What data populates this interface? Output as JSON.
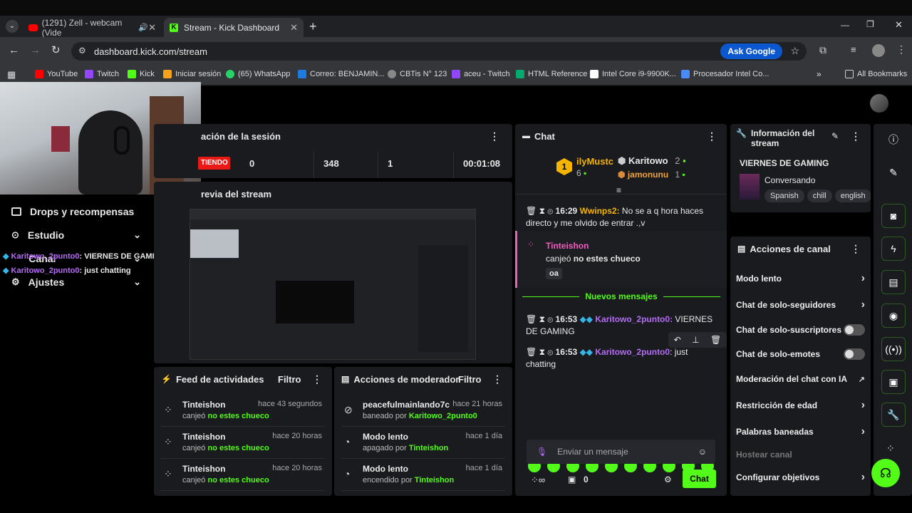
{
  "browser": {
    "tabs": [
      {
        "label": "(1291) Zell - webcam (Vide"
      },
      {
        "label": "Stream - Kick Dashboard"
      }
    ],
    "url": "dashboard.kick.com/stream",
    "ask_google": "Ask Google",
    "bookmarks": [
      "YouTube",
      "Twitch",
      "Kick",
      "Iniciar sesión",
      "(65) WhatsApp",
      "Correo: BENJAMIN...",
      "CBTis N° 123",
      "aceu - Twitch",
      "HTML Reference",
      "Intel Core i9-9900K...",
      "Procesador Intel Co..."
    ],
    "all_bookmarks": "All Bookmarks"
  },
  "sidebar": {
    "items": [
      {
        "label": "Drops y recompensas"
      },
      {
        "label": "Estudio"
      },
      {
        "label": "Canal"
      },
      {
        "label": "Ajustes"
      }
    ],
    "overlay_chat": [
      {
        "user": "Karitowo_2punto0",
        "text": ": VIERNES DE GAMING"
      },
      {
        "user": "Karitowo_2punto0",
        "text": ": just chatting"
      }
    ]
  },
  "session": {
    "title": "ación de la sesión",
    "status": "TIENDO",
    "stats": [
      "0",
      "348",
      "1",
      "00:01:08"
    ]
  },
  "preview": {
    "title": "revia del stream"
  },
  "feed": {
    "title": "Feed de actividades",
    "filter": "Filtro",
    "items": [
      {
        "user": "Tinteishon",
        "time": "hace 43 segundos",
        "verb": "canjeó",
        "reward": "no estes chueco"
      },
      {
        "user": "Tinteishon",
        "time": "hace 20 horas",
        "verb": "canjeó",
        "reward": "no estes chueco"
      },
      {
        "user": "Tinteishon",
        "time": "hace 20 horas",
        "verb": "canjeó",
        "reward": "no estes chueco"
      }
    ]
  },
  "mod": {
    "title": "Acciones de moderador",
    "filter": "Filtro",
    "items": [
      {
        "title": "peacefulmainlando7c",
        "time": "hace 21 horas",
        "verb": "baneado por",
        "by": "Karitowo_2punto0"
      },
      {
        "title": "Modo lento",
        "time": "hace 1 día",
        "verb": "apagado por",
        "by": "Tinteishon"
      },
      {
        "title": "Modo lento",
        "time": "hace 1 día",
        "verb": "encendido por",
        "by": "Tinteishon"
      }
    ]
  },
  "chat": {
    "title": "Chat",
    "leaderboard": {
      "first_user": "ilyMustc",
      "first_rank": "1",
      "first_count": "6",
      "second_user": "Karitowo",
      "second_count": "2",
      "third_user": "jamonunu",
      "third_count": "1"
    },
    "msg1": {
      "time": "16:29",
      "user": "Wwinps2:",
      "text": "No se a q hora haces directo y me olvido de entrar .,v"
    },
    "redeem": {
      "user": "Tinteishon",
      "verb": "canjeó",
      "reward": "no estes chueco",
      "input": "oa"
    },
    "new_messages": "Nuevos mensajes",
    "msg2": {
      "time": "16:53",
      "user": "Karitowo_2punto0:",
      "text": "VIERNES DE GAMING"
    },
    "msg3": {
      "time": "16:53",
      "user": "Karitowo_2punto0",
      "text": ": just chatting"
    },
    "input_placeholder": "Enviar un mensaje",
    "points": "0",
    "send": "Chat"
  },
  "info": {
    "title": "Información del stream",
    "stream_title": "VIERNES DE GAMING",
    "category": "Conversando",
    "tags": [
      "Spanish",
      "chill",
      "english"
    ]
  },
  "channel_actions": {
    "title": "Acciones de canal",
    "items": [
      "Modo lento",
      "Chat de solo-seguidores",
      "Chat de solo-suscriptores",
      "Chat de solo-emotes",
      "Moderación del chat con IA",
      "Restricción de edad",
      "Palabras baneadas",
      "Hostear canal",
      "Configurar objetivos"
    ]
  },
  "colors": {
    "accent": "#53fc18",
    "panel": "#191b1f",
    "pink": "#f25ec0",
    "purple": "#b56cf4"
  }
}
